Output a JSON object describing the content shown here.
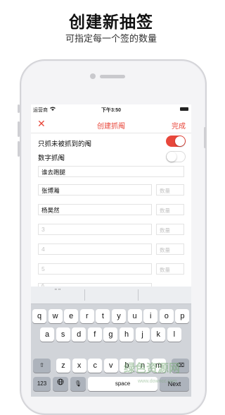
{
  "header": {
    "title": "创建新抽签",
    "subtitle": "可指定每一个签的数量"
  },
  "status_bar": {
    "carrier": "运营商",
    "time": "下午3:50"
  },
  "nav": {
    "close_icon": "close-icon",
    "title": "创建抓阄",
    "done_label": "完成"
  },
  "options": [
    {
      "label": "只抓未被抓到的阄",
      "on": true
    },
    {
      "label": "数字抓阄",
      "on": false
    }
  ],
  "name_field": {
    "value": "谁去跑腿"
  },
  "entries": [
    {
      "value": "张博瀚",
      "qty_placeholder": "数量",
      "is_placeholder": false
    },
    {
      "value": "杨昊然",
      "qty_placeholder": "数量",
      "is_placeholder": false
    },
    {
      "value": "3",
      "qty_placeholder": "数量",
      "is_placeholder": true
    },
    {
      "value": "4",
      "qty_placeholder": "数量",
      "is_placeholder": true
    },
    {
      "value": "5",
      "qty_placeholder": "数量",
      "is_placeholder": true
    },
    {
      "value": "6",
      "qty_placeholder": "",
      "is_placeholder": true
    }
  ],
  "keyboard": {
    "suggestion": "\" \"",
    "row1": [
      "q",
      "w",
      "e",
      "r",
      "t",
      "y",
      "u",
      "i",
      "o",
      "p"
    ],
    "row2": [
      "a",
      "s",
      "d",
      "f",
      "g",
      "h",
      "j",
      "k",
      "l"
    ],
    "row3": [
      "z",
      "x",
      "c",
      "v",
      "b",
      "n",
      "m"
    ],
    "shift_icon": "shift-icon",
    "delete_icon": "delete-icon",
    "numbers_label": "123",
    "globe_icon": "globe-icon",
    "mic_icon": "microphone-icon",
    "space_label": "space",
    "next_label": "Next"
  },
  "watermark": {
    "text": "绿色资源网",
    "url": "www.downcc.com"
  },
  "colors": {
    "accent": "#e8473b",
    "keyboard_bg": "#d1d4d9"
  }
}
